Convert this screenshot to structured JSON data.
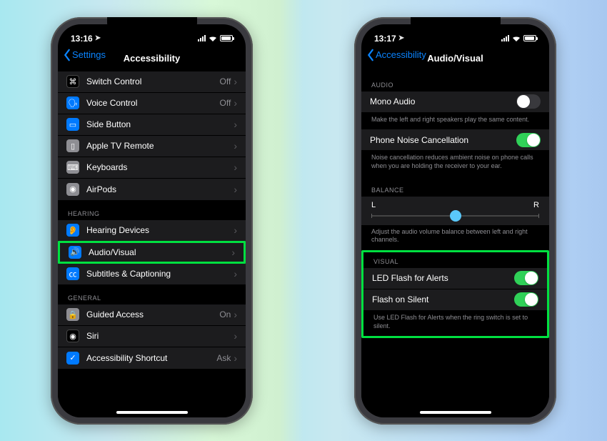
{
  "phone1": {
    "status": {
      "time": "13:16"
    },
    "nav": {
      "back": "Settings",
      "title": "Accessibility"
    },
    "group_physical": [
      {
        "icon": "switch-control-icon",
        "cls": "ic-black",
        "glyph": "⌘",
        "label": "Switch Control",
        "value": "Off"
      },
      {
        "icon": "voice-control-icon",
        "cls": "ic-blue",
        "glyph": "🗣",
        "label": "Voice Control",
        "value": "Off"
      },
      {
        "icon": "side-button-icon",
        "cls": "ic-blue",
        "glyph": "▭",
        "label": "Side Button",
        "value": ""
      },
      {
        "icon": "tv-remote-icon",
        "cls": "ic-gray",
        "glyph": "▯",
        "label": "Apple TV Remote",
        "value": ""
      },
      {
        "icon": "keyboards-icon",
        "cls": "ic-gray",
        "glyph": "⌨",
        "label": "Keyboards",
        "value": ""
      },
      {
        "icon": "airpods-icon",
        "cls": "ic-gray",
        "glyph": "◉",
        "label": "AirPods",
        "value": ""
      }
    ],
    "hearing_hdr": "HEARING",
    "group_hearing": [
      {
        "icon": "hearing-icon",
        "cls": "ic-blue",
        "glyph": "👂",
        "label": "Hearing Devices",
        "value": ""
      },
      {
        "icon": "audio-visual-icon",
        "cls": "ic-blue",
        "glyph": "🔊",
        "label": "Audio/Visual",
        "value": "",
        "hl": true
      },
      {
        "icon": "subtitles-icon",
        "cls": "ic-blue",
        "glyph": "㏄",
        "label": "Subtitles & Captioning",
        "value": ""
      }
    ],
    "general_hdr": "GENERAL",
    "group_general": [
      {
        "icon": "guided-access-icon",
        "cls": "ic-gray",
        "glyph": "🔒",
        "label": "Guided Access",
        "value": "On"
      },
      {
        "icon": "siri-icon",
        "cls": "ic-black",
        "glyph": "◉",
        "label": "Siri",
        "value": ""
      },
      {
        "icon": "shortcut-icon",
        "cls": "ic-blue",
        "glyph": "✓",
        "label": "Accessibility Shortcut",
        "value": "Ask"
      }
    ]
  },
  "phone2": {
    "status": {
      "time": "13:17"
    },
    "nav": {
      "back": "Accessibility",
      "title": "Audio/Visual"
    },
    "audio_hdr": "AUDIO",
    "mono": {
      "label": "Mono Audio",
      "on": false,
      "foot": "Make the left and right speakers play the same content."
    },
    "noise": {
      "label": "Phone Noise Cancellation",
      "on": true,
      "foot": "Noise cancellation reduces ambient noise on phone calls when you are holding the receiver to your ear."
    },
    "balance_hdr": "BALANCE",
    "balance": {
      "left": "L",
      "right": "R",
      "foot": "Adjust the audio volume balance between left and right channels."
    },
    "visual_hdr": "VISUAL",
    "led": {
      "label": "LED Flash for Alerts",
      "on": true
    },
    "flash_silent": {
      "label": "Flash on Silent",
      "on": true
    },
    "visual_foot": "Use LED Flash for Alerts when the ring switch is set to silent."
  }
}
